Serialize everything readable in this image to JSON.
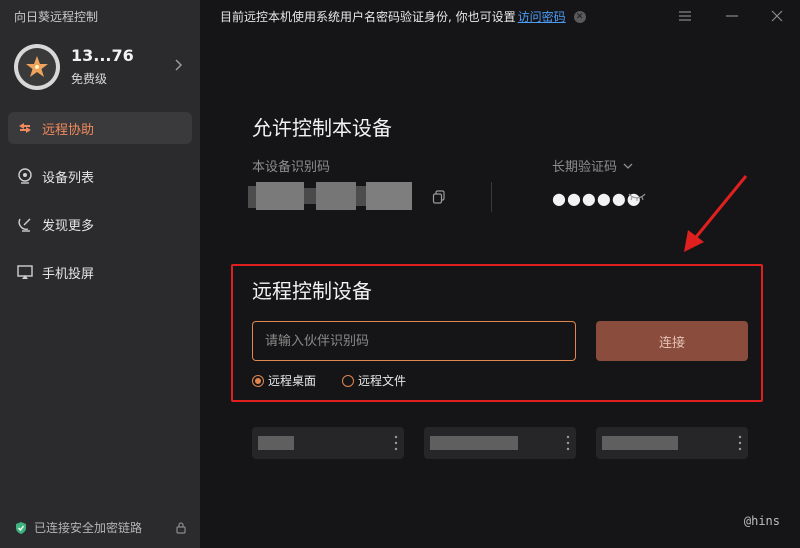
{
  "app": {
    "title": "向日葵远程控制"
  },
  "profile": {
    "name": "13...76",
    "level": "免费级"
  },
  "nav": {
    "items": [
      {
        "label": "远程协助",
        "icon": "remote-assist-icon",
        "active": true
      },
      {
        "label": "设备列表",
        "icon": "device-list-icon",
        "active": false
      },
      {
        "label": "发现更多",
        "icon": "discover-icon",
        "active": false
      },
      {
        "label": "手机投屏",
        "icon": "screen-cast-icon",
        "active": false
      }
    ]
  },
  "security": {
    "text": "已连接安全加密链路"
  },
  "notice": {
    "text": "目前远控本机使用系统用户名密码验证身份, 你也可设置",
    "link": "访问密码"
  },
  "allow": {
    "title": "允许控制本设备",
    "device_code_label": "本设备识别码",
    "verify_code_label": "长期验证码",
    "verify_code_value": "●●●●●●"
  },
  "remote": {
    "title": "远程控制设备",
    "input_placeholder": "请输入伙伴识别码",
    "connect_label": "连接",
    "options": [
      {
        "label": "远程桌面",
        "checked": true
      },
      {
        "label": "远程文件",
        "checked": false
      }
    ]
  },
  "watermark": "@hins",
  "colors": {
    "accent": "#f08a5d",
    "highlight_box": "#e0201f",
    "link": "#4e9bf5",
    "connect_bg": "#8a4d3d"
  }
}
